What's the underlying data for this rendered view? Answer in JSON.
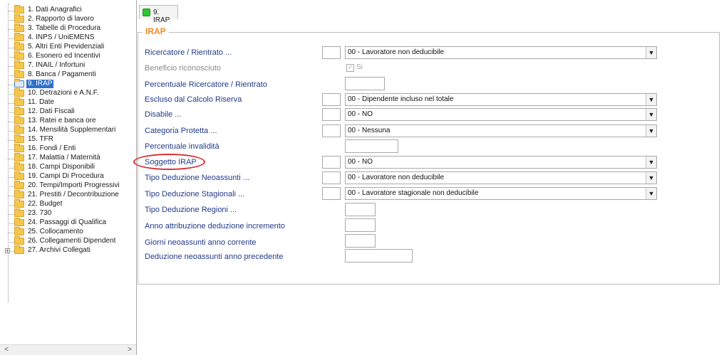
{
  "tree": {
    "items": [
      {
        "label": "1. Dati Anagrafici"
      },
      {
        "label": "2. Rapporto di lavoro"
      },
      {
        "label": "3. Tabelle di Procedura"
      },
      {
        "label": "4. INPS / UniEMENS"
      },
      {
        "label": "5. Altri Enti Previdenziali"
      },
      {
        "label": "6. Esonero ed Incentivi"
      },
      {
        "label": "7. INAIL / Infortuni"
      },
      {
        "label": "8. Banca / Pagamenti"
      },
      {
        "label": "9. IRAP"
      },
      {
        "label": "10. Detrazioni e A.N.F."
      },
      {
        "label": "11. Date"
      },
      {
        "label": "12. Dati Fiscali"
      },
      {
        "label": "13. Ratei e banca ore"
      },
      {
        "label": "14. Mensilità Supplementari"
      },
      {
        "label": "15. TFR"
      },
      {
        "label": "16. Fondi / Enti"
      },
      {
        "label": "17. Malattia / Maternità"
      },
      {
        "label": "18. Campi Disponibili"
      },
      {
        "label": "19. Campi Di Procedura"
      },
      {
        "label": "20. Tempi/Importi Progressivi"
      },
      {
        "label": "21. Prestiti / Decontribuzione"
      },
      {
        "label": "22. Budget"
      },
      {
        "label": "23. 730"
      },
      {
        "label": "24. Passaggi di Qualifica"
      },
      {
        "label": "25. Collocamento"
      },
      {
        "label": "26. Collegamenti Dipendent"
      },
      {
        "label": "27. Archivi Collegati"
      }
    ],
    "selected_index": 8,
    "expander_symbol": "+",
    "scroll_left": "<",
    "scroll_right": ">"
  },
  "tab": {
    "label": "9. IRAP",
    "accent": "#2ec62e"
  },
  "section": {
    "title": "IRAP",
    "title_color": "#f28a1e"
  },
  "fields": {
    "ricercatore": {
      "label": "Ricercatore / Rientrato ...",
      "value": "00 - Lavoratore non deducibile"
    },
    "beneficio": {
      "label": "Beneficio riconosciuto",
      "checkbox_label": "Si",
      "checked": true
    },
    "percentuale_ricercatore": {
      "label": "Percentuale Ricercatore / Rientrato"
    },
    "escluso": {
      "label": "Escluso dal Calcolo Riserva",
      "value": "00 - Dipendente incluso nel totale"
    },
    "disabile": {
      "label": "Disabile ...",
      "value": "00 - NO"
    },
    "categoria": {
      "label": "Categoria Protetta ...",
      "value": "00 - Nessuna"
    },
    "percentuale_invalidita": {
      "label": "Percentuale invalidità"
    },
    "soggetto": {
      "label": "Soggetto IRAP",
      "value": "00 - NO"
    },
    "tipo_neoassunti": {
      "label": "Tipo Deduzione Neoassunti ...",
      "value": "00 - Lavoratore non deducibile"
    },
    "tipo_stagionali": {
      "label": "Tipo Deduzione Stagionali ...",
      "value": "00 - Lavoratore stagionale non deducibile"
    },
    "tipo_regioni": {
      "label": "Tipo Deduzione Regioni ..."
    },
    "anno_attribuzione": {
      "label": "Anno attribuzione deduzione incremento"
    },
    "giorni_neoassunti": {
      "label": "Giorni neoassunti anno corrente"
    },
    "deduzione_precedente": {
      "label": "Deduzione neoassunti anno precedente"
    }
  },
  "dropdown_arrow": "▼",
  "highlight_color": "#d92e2e"
}
